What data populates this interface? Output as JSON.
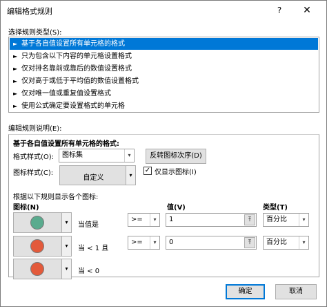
{
  "window": {
    "title": "编辑格式规则",
    "help_label": "?",
    "close_label": "✕"
  },
  "rule_type": {
    "label": "选择规则类型(S):",
    "items": [
      "基于各自值设置所有单元格的格式",
      "只为包含以下内容的单元格设置格式",
      "仅对排名靠前或靠后的数值设置格式",
      "仅对高于或低于平均值的数值设置格式",
      "仅对唯一值或重复值设置格式",
      "使用公式确定要设置格式的单元格"
    ],
    "selected_index": 0
  },
  "description": {
    "label": "编辑规则说明(E):",
    "heading": "基于各自值设置所有单元格的格式:",
    "format_style_label": "格式样式(O):",
    "format_style_value": "图标集",
    "reverse_button": "反转图标次序(D)",
    "icon_style_label": "图标样式(C):",
    "icon_style_value": "自定义",
    "show_icon_only_label": "仅显示图标(I)",
    "show_icon_only_checked": true,
    "rules_caption": "根据以下规则显示各个图标:",
    "col_icon": "图标(N)",
    "col_value": "值(V)",
    "col_type": "类型(T)",
    "rows": [
      {
        "icon_color": "#5aab8e",
        "condition": "当值是",
        "operator": ">=",
        "value": "1",
        "type": "百分比"
      },
      {
        "icon_color": "#e35a3b",
        "condition": "当 < 1 且",
        "operator": ">=",
        "value": "0",
        "type": "百分比"
      },
      {
        "icon_color": "#e35a3b",
        "condition": "当 < 0"
      }
    ]
  },
  "buttons": {
    "ok": "确定",
    "cancel": "取消"
  }
}
